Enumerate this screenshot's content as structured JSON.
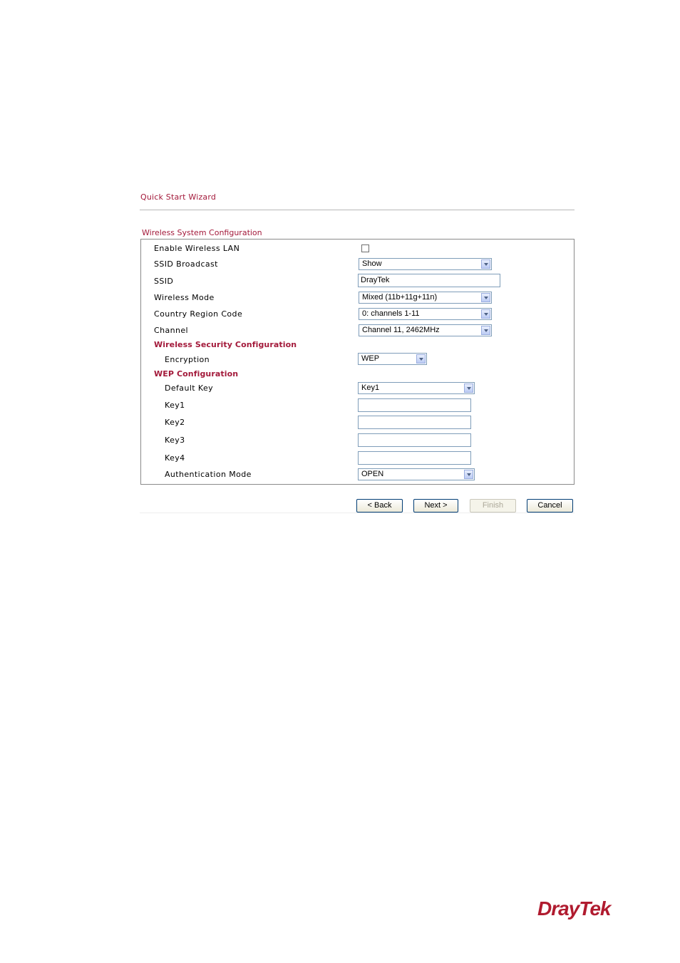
{
  "wizard": {
    "title": "Quick Start Wizard",
    "section_title": "Wireless System Configuration"
  },
  "form": {
    "enable_wlan": {
      "label": "Enable Wireless LAN",
      "checked": false
    },
    "ssid_broadcast": {
      "label": "SSID Broadcast",
      "value": "Show"
    },
    "ssid": {
      "label": "SSID",
      "value": "DrayTek"
    },
    "wireless_mode": {
      "label": "Wireless Mode",
      "value": "Mixed (11b+11g+11n)"
    },
    "country_region": {
      "label": "Country Region Code",
      "value": "0: channels 1-11"
    },
    "channel": {
      "label": "Channel",
      "value": "Channel 11, 2462MHz"
    },
    "security_section": "Wireless Security Configuration",
    "encryption": {
      "label": "Encryption",
      "value": "WEP"
    },
    "wep_section": "WEP Configuration",
    "default_key": {
      "label": "Default Key",
      "value": "Key1"
    },
    "key1": {
      "label": "Key1",
      "value": ""
    },
    "key2": {
      "label": "Key2",
      "value": ""
    },
    "key3": {
      "label": "Key3",
      "value": ""
    },
    "key4": {
      "label": "Key4",
      "value": ""
    },
    "auth_mode": {
      "label": "Authentication Mode",
      "value": "OPEN"
    }
  },
  "buttons": {
    "back": "< Back",
    "next": "Next >",
    "finish": "Finish",
    "cancel": "Cancel"
  },
  "brand": {
    "logo_text": "DrayTek",
    "color": "#b01b2f",
    "accent": "#a3193a"
  }
}
